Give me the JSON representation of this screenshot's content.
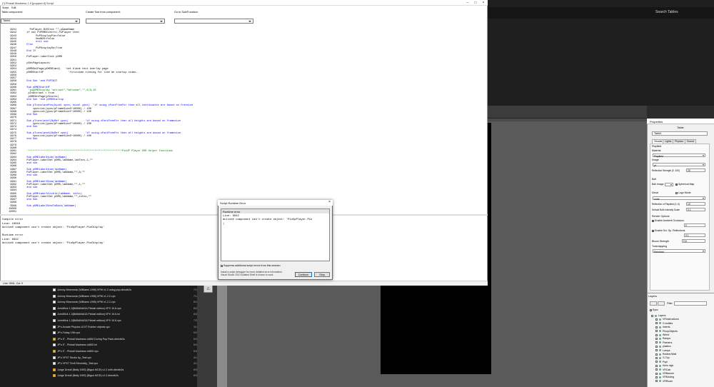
{
  "search": {
    "label": "Search Tables"
  },
  "editor": {
    "title": "[*] Pinball Madness 1.0 [popped.tl] Script",
    "menu": [
      "Script",
      "Edit"
    ],
    "labels": {
      "table_component": "Table component:",
      "create_sub": "Create Sub from component:",
      "goto_sub": "Go to Sub/Function:"
    },
    "component_value": "Table1",
    "status": "Line: 9941, Col: 0",
    "code_lines": [
      {
        "n": "9941",
        "t": "    PuPlayer.B2SInit \"\",pGameName"
      },
      {
        "n": "9942",
        "t": "  if not PUPDMDControl.PuPlayer then"
      },
      {
        "n": "9943",
        "t": "        PuPDisplayPin=False"
      },
      {
        "n": "9944",
        "t": "        DmdB2S=False"
      },
      {
        "n": "9945",
        "t": "        exit sub"
      },
      {
        "n": "9946",
        "t": "  Else"
      },
      {
        "n": "9947",
        "t": "        PuPDisplayOn=True"
      },
      {
        "n": "9948",
        "t": "  End If"
      },
      {
        "n": "9949",
        "t": ""
      },
      {
        "n": "9950",
        "t": "  PuPlayer.LabelInit pDMD"
      },
      {
        "n": "9951",
        "t": ""
      },
      {
        "n": "9952",
        "t": "  pSetPageLayouts"
      },
      {
        "n": "9953",
        "t": ""
      },
      {
        "n": "9954",
        "t": "  pDMDSetPage(pDMDBlank)   'set blank text overlay page"
      },
      {
        "n": "9955",
        "t": "  pDMDStartUP                'firsttime running for like an startup video.."
      },
      {
        "n": "9956",
        "t": ""
      },
      {
        "n": "9957",
        "t": ""
      },
      {
        "n": "9958",
        "t": "  End Sub 'end PUPINIT"
      },
      {
        "n": "9959",
        "t": ""
      },
      {
        "n": "9960",
        "t": "  Sub pDMDStartUP"
      },
      {
        "n": "9961",
        "t": "   'pupDMDDisplay \"attract\",\"Welcome\",\"\",9,0,10"
      },
      {
        "n": "9962",
        "t": "   pInAttract = true"
      },
      {
        "n": "9963",
        "t": "   pDMDSetPage(pScores)"
      },
      {
        "n": "9964",
        "t": "  end Sub 'end pDMDStartup"
      },
      {
        "n": "9965",
        "t": ""
      },
      {
        "n": "9966",
        "t": "  Sub pTranslatePos(byval xpos, byval ypos)  'if using xFontFreeFor then all coordinates are based on freesize"
      },
      {
        "n": "9967",
        "t": "      xpos=int(xpos/pFrameSizeX*10000) / 100"
      },
      {
        "n": "9968",
        "t": "      ypos=int(ypos/pFrameSizeY*10000) / 100"
      },
      {
        "n": "9969",
        "t": "  end Sub"
      },
      {
        "n": "9970",
        "t": ""
      },
      {
        "n": "9971",
        "t": "  Sub pTranslateY(ByRef ypos)           'if using xFontFreeFor then all heights are based on framesize"
      },
      {
        "n": "9972",
        "t": "      ypos=int(ypos/pFrameSizeY*10000) / 100"
      },
      {
        "n": "9973",
        "t": "  end Sub"
      },
      {
        "n": "9974",
        "t": ""
      },
      {
        "n": "9975",
        "t": "  Sub pTranslateX(ByRef xpos)           'if using xFontFreeFor then all heights are based on framesize"
      },
      {
        "n": "9976",
        "t": "      xpos=int(xpos/pFrameSizeX*10000) / 100"
      },
      {
        "n": "9977",
        "t": "  end Sub"
      },
      {
        "n": "9978",
        "t": ""
      },
      {
        "n": "9979",
        "t": ""
      },
      {
        "n": "9980",
        "t": ""
      },
      {
        "n": "9981",
        "t": "  '*************************************************************PinUP Player DMD Helper Functions"
      },
      {
        "n": "9982",
        "t": ""
      },
      {
        "n": "9983",
        "t": "  Sub pDMDLabelHide(labName)"
      },
      {
        "n": "9984",
        "t": "  PuPlayer.LabelSet pDMD,labName,labText,1,\"\""
      },
      {
        "n": "9985",
        "t": "  end sub"
      },
      {
        "n": "9986",
        "t": ""
      },
      {
        "n": "9987",
        "t": "  Sub pDMDLabelHide(labName)"
      },
      {
        "n": "9988",
        "t": "  PuPlayer.LabelSet pDMD,labName,\"\",0,\"\""
      },
      {
        "n": "9989",
        "t": "  end sub"
      },
      {
        "n": "9990",
        "t": ""
      },
      {
        "n": "9991",
        "t": "  Sub pDMDLabelShow(labName)"
      },
      {
        "n": "9992",
        "t": "  PuPlayer.LabelSet pDMD,labName,\"\",1,\"\""
      },
      {
        "n": "9993",
        "t": "  end sub"
      },
      {
        "n": "9994",
        "t": ""
      },
      {
        "n": "9995",
        "t": "  Sub pDMDLabelVisible(labName, isVis)"
      },
      {
        "n": "9996",
        "t": "  PuPlayer.LabelSet pDMD,labName,\"\",isVis,\"\""
      },
      {
        "n": "9997",
        "t": "  end Sub"
      },
      {
        "n": "9998",
        "t": ""
      },
      {
        "n": "9999",
        "t": "  Sub pDMDLabelSendToBack(labName)"
      },
      {
        "n": "10000",
        "t": ""
      },
      {
        "n": "10001",
        "t": ""
      }
    ],
    "output_lines": [
      "Compile error",
      "Line: 10018",
      "ActiveX component can't create object: 'PinUpPlayer.PinDisplay'",
      "",
      "Runtime error",
      "Line: 9942",
      "ActiveX component can't create object: 'PinUpPlayer.PinDisplay'"
    ]
  },
  "dialog": {
    "title": "Script Runtime Error",
    "heading": "Runtime error",
    "lines": [
      "Line: 9942",
      "ActiveX component can't create object: 'PinUpPlayer.Pin"
    ],
    "suppress_label": "Suppress additional script errors from this session",
    "info": [
      "Install a script debugger for more detailed error information.",
      "Visual Studio 2010 Isolated Shell is known to work."
    ],
    "continue": "Continue",
    "stop": "Stop"
  },
  "explorer": {
    "files": [
      {
        "name": "Johnny Mnemonic (Williams 1995) VPW v1.2 using pup.directb2s",
        "date": "7/1/2",
        "icon": "doc"
      },
      {
        "name": "Johnny Mnemonic (Williams 1995) VPW v1.2.2.vpx",
        "date": "7/1/2",
        "icon": "doc"
      },
      {
        "name": "Johnny Mnemonic (Williams 1995) VPW v1.2.2.vpx",
        "date": "8/10/",
        "icon": "doc"
      },
      {
        "name": "JohnWick 1.3(BABANAGA Pinball edition) VPX 10.6.vpx",
        "date": "8/2/2",
        "icon": "doc"
      },
      {
        "name": "JohnWick 1.3(BABANAGA Pinball edition) VPX 10.6.ini",
        "date": "6/30/",
        "icon": "doc"
      },
      {
        "name": "JohnWick 1.3(BABANAGA Pinball edition) VPX 10.6.vpx",
        "date": "7/25/",
        "icon": "doc"
      },
      {
        "name": "JP's Arcade Physics v3.0T Rubber objects.vpx",
        "date": "11/2/",
        "icon": "doc"
      },
      {
        "name": "JP's Friday 13th.vpx",
        "date": "5/2/2",
        "icon": "doc"
      },
      {
        "name": "JP's IT - Pinball Madness v4600 During Pup Pack.directb2s",
        "date": "5/30/",
        "icon": "zip"
      },
      {
        "name": "JP's IT - Pinball Madness v4600.ini",
        "date": "5/30/",
        "icon": "doc"
      },
      {
        "name": "JP's IT - Pinball Madness v4600.vpx",
        "date": "5/30/",
        "icon": "zip"
      },
      {
        "name": "JP's VPX7 Studio by_Test.vpx",
        "date": "4/12/",
        "icon": "doc"
      },
      {
        "name": "JP's VPX7 Ten5 Electricity_Test.vpx",
        "date": "4/12/",
        "icon": "doc"
      },
      {
        "name": "Judge Dredd (Bally 1993) (Bigus MOD) v1.2 with.directb2s",
        "date": "8/3/2",
        "icon": "zip"
      },
      {
        "name": "Judge Dredd (Bally 1993) (Bigus MOD) v1.2.directb2s",
        "date": "8/3/2",
        "icon": "zip"
      }
    ]
  },
  "properties": {
    "title": "Properties",
    "subtitle": "Table",
    "name_value": "Table1",
    "tabs": [
      "Visuals",
      "Lights",
      "Physics",
      "Sound"
    ],
    "playfield_group": "Playfield",
    "material_label": "Material",
    "material_value": "Playfield",
    "image_label": "Image",
    "image_value": "pf",
    "reflection_label": "Reflection Strength (0..100)",
    "reflection_value": "20",
    "ball_group": "Ball",
    "ball_image_label": "Ball Image",
    "spherical_label": "Spherical Map",
    "decal_label": "Decal",
    "logo_mode_label": "Logo Mode",
    "decal_value": "none",
    "refl_playfield_label": "Reflection of Playfield (0..5)",
    "refl_playfield_value": "10",
    "bulb_label": "Default Bulb Intensity Scale",
    "bulb_value": "0.1",
    "render_group": "Render Options",
    "ao_label": "Enable Ambient Occlusion",
    "ao_value": "0",
    "ssr_label": "Enable Scr. Sp. Reflections",
    "ssr_value": "0.1",
    "bloom_label": "Bloom Strength",
    "bloom_value": "0.8",
    "tonemap_label": "Tonemapping",
    "tonemap_value": "Reinhard"
  },
  "layers": {
    "title": "Layers",
    "filter_label": "Filter",
    "sync_label": "Sync",
    "items": [
      "Layers",
      "VRInstructions",
      "G-bottles",
      "Inserts",
      "PinupObjects",
      "Wired",
      "Ramps",
      "Flashers",
      "plastics",
      "Lamps",
      "Rubber/Wall",
      "G-Top",
      "Pupl",
      "Kiers sign",
      "VRCab",
      "VRBanner",
      "VRMoving",
      "VRRoom"
    ]
  }
}
